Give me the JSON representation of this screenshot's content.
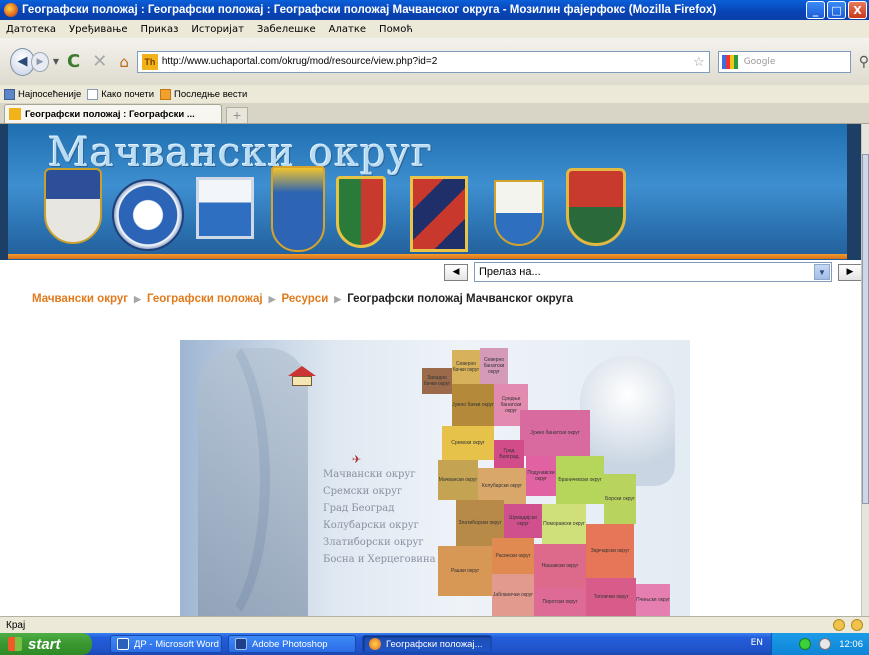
{
  "window": {
    "title": "Географски положај : Географски положај : Географски положај Мачванског округа - Мозилин фајерфокс (Mozilla Firefox)",
    "buttons": {
      "minimize": "_",
      "maximize": "□",
      "close": "X"
    }
  },
  "menu": [
    "Датотека",
    "Уређивање",
    "Приказ",
    "Историјат",
    "Забелешке",
    "Алатке",
    "Помоћ"
  ],
  "nav": {
    "url": "http://www.uchaportal.com/okrug/mod/resource/view.php?id=2",
    "search_placeholder": "Google"
  },
  "bookmarks": [
    "Најпосећеније",
    "Како почети",
    "Последње вести"
  ],
  "tabs": [
    {
      "label": "Географски положај : Географски ..."
    }
  ],
  "page": {
    "banner_title": "Мачвански округ",
    "jump_select": "Прелаз на...",
    "breadcrumb": {
      "items": [
        "Мачвански округ",
        "Географски положај",
        "Ресурси"
      ],
      "separator": "▶",
      "current": "Географски положај Мачванског округа"
    },
    "map_links": [
      "Мачвански округ",
      "Сремски округ",
      "Град Београд",
      "Колубарски округ",
      "Златиборски округ",
      "Босна и Херцеговина"
    ],
    "map_regions": [
      "Северно бачки округ",
      "Северно банатски округ",
      "Западно бачки округ",
      "Јужно бачки округ",
      "Средње банатски округ",
      "Јужно банатски округ",
      "Сремски округ",
      "Град Београд",
      "Мачвански округ",
      "Колубарски округ",
      "Подунавски округ",
      "Браничевски округ",
      "Борски округ",
      "Златиборски округ",
      "Шумадијски округ",
      "Поморавски округ",
      "Рашки округ",
      "Расински округ",
      "Нишавски округ",
      "Зајечарски округ",
      "Јабланички округ",
      "Пиротски округ",
      "Топлички округ",
      "Пчињски округ"
    ]
  },
  "status": {
    "text": "Крај"
  },
  "taskbar": {
    "start": "start",
    "tasks": [
      "ДР - Microsoft Word",
      "Adobe Photoshop",
      "Географски положај..."
    ],
    "lang": "EN",
    "clock": "12:06"
  },
  "colors": {
    "breadcrumb_link": "#e07a1c",
    "banner": "#2a7cc0",
    "accent_line": "#f39b2e"
  }
}
